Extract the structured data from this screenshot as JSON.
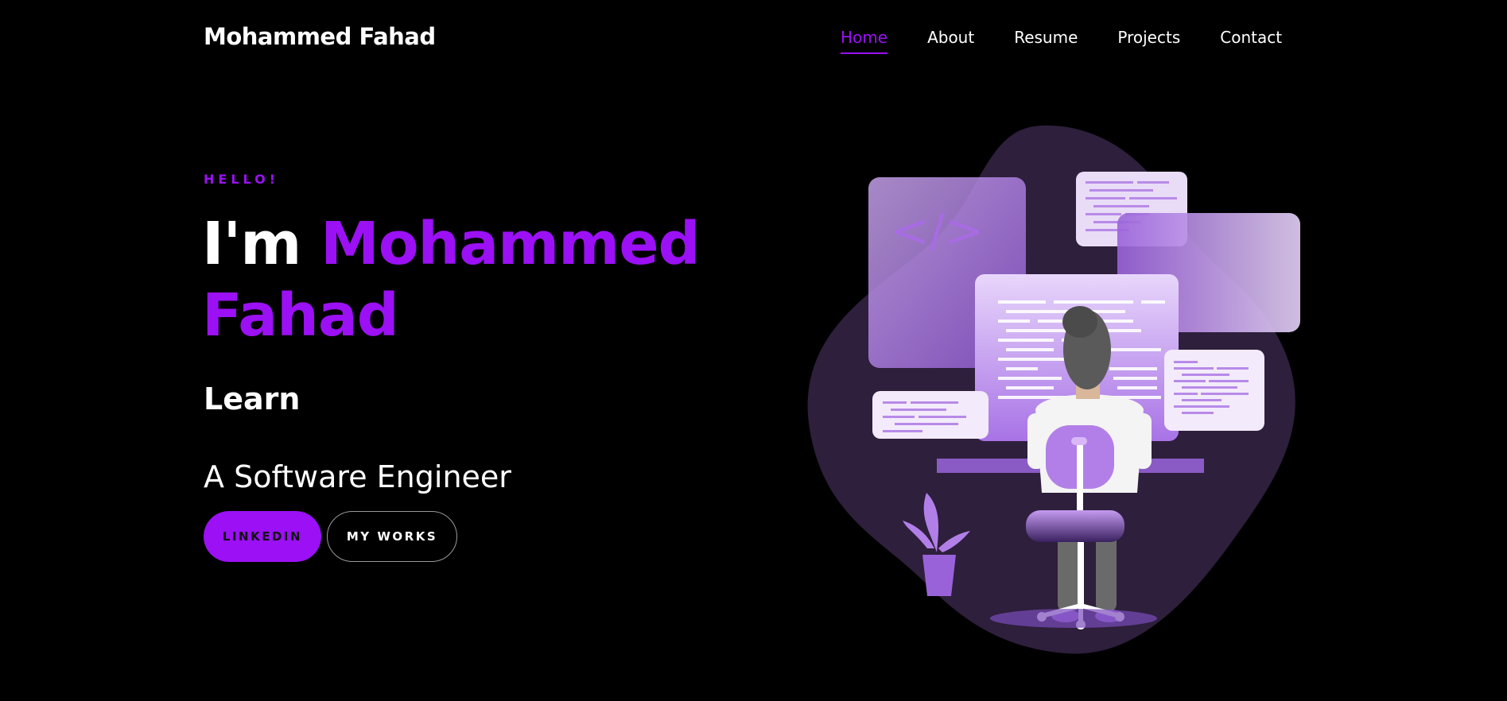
{
  "brand": "Mohammed Fahad",
  "nav": {
    "items": [
      {
        "label": "Home",
        "active": true
      },
      {
        "label": "About",
        "active": false
      },
      {
        "label": "Resume",
        "active": false
      },
      {
        "label": "Projects",
        "active": false
      },
      {
        "label": "Contact",
        "active": false
      }
    ]
  },
  "hero": {
    "greeting": "HELLO!",
    "title_prefix": "I'm",
    "title_name_line1": "Mohammed",
    "title_name_line2": "Fahad",
    "typed_word": "Learn",
    "role": "A Software Engineer",
    "buttons": {
      "primary": "LINKEDIN",
      "secondary": "MY WORKS"
    }
  },
  "illustration": {
    "icon": "developer-at-desk-illustration",
    "code_symbol": "</>"
  },
  "colors": {
    "background": "#000000",
    "accent": "#9b10f5",
    "text": "#ffffff",
    "blob": "#2d1f3b",
    "panel_light": "#d9b8f7",
    "panel_mid": "#a56fe0"
  }
}
